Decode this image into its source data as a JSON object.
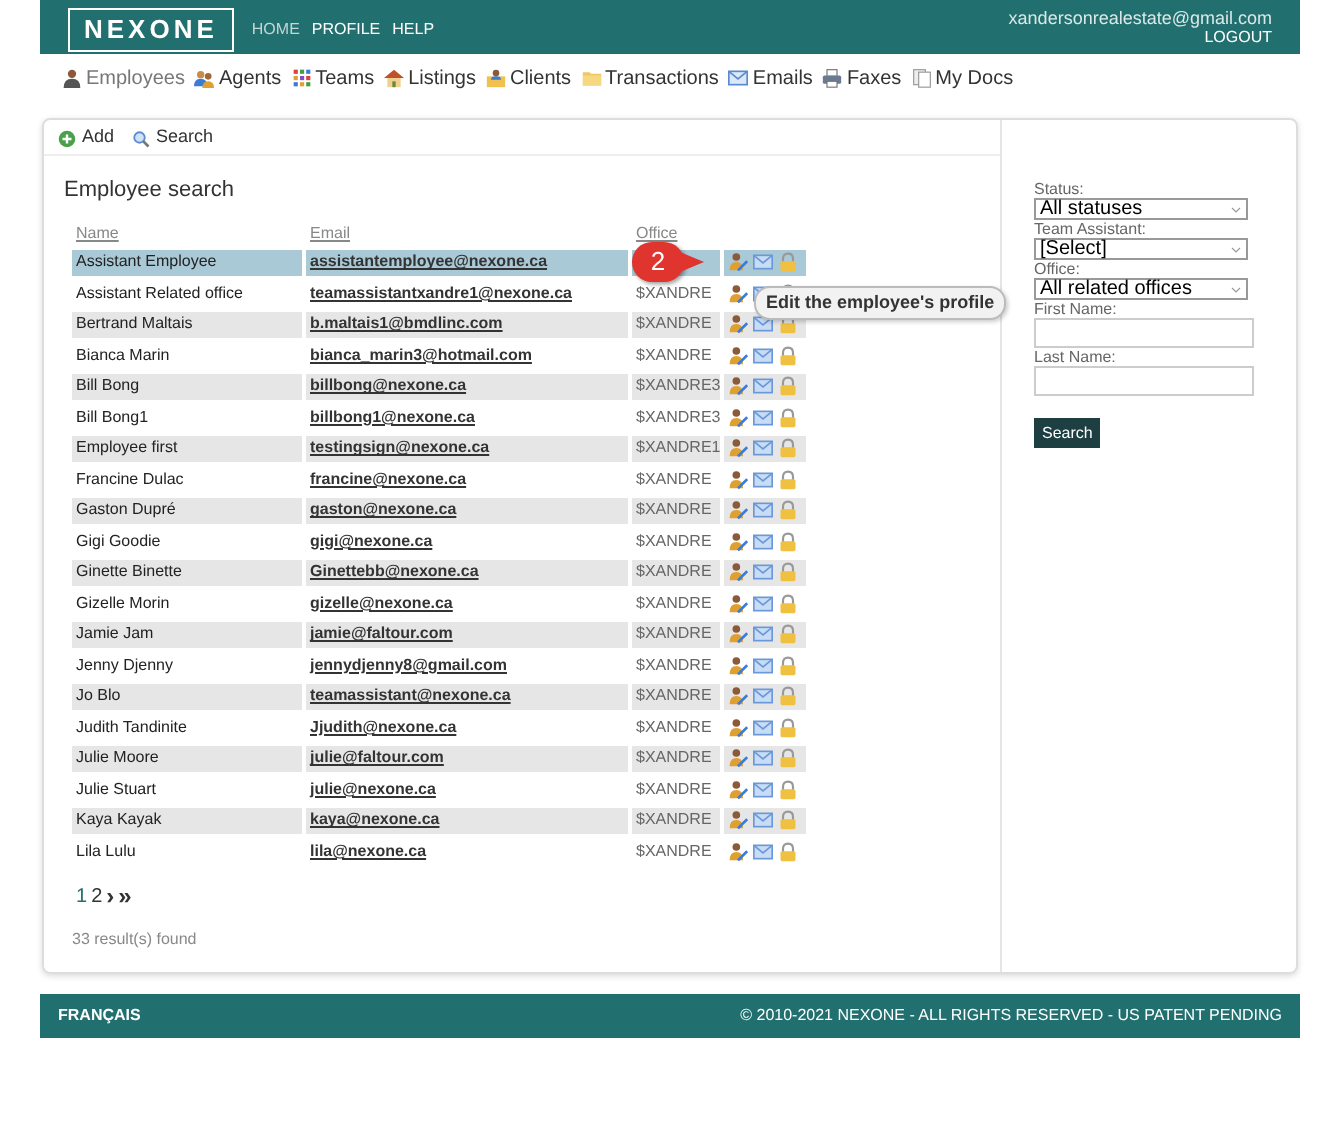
{
  "header": {
    "logo": "NEXONE",
    "nav_links": [
      {
        "label": "HOME",
        "selected": true
      },
      {
        "label": "PROFILE",
        "selected": false
      },
      {
        "label": "HELP",
        "selected": false
      }
    ],
    "user_email": "xandersonrealestate@gmail.com",
    "logout": "LOGOUT"
  },
  "tabs": [
    {
      "label": "Employees",
      "kind": "person",
      "selected": true
    },
    {
      "label": "Agents",
      "kind": "agents",
      "selected": false
    },
    {
      "label": "Teams",
      "kind": "grid",
      "selected": false
    },
    {
      "label": "Listings",
      "kind": "house",
      "selected": false
    },
    {
      "label": "Clients",
      "kind": "clients",
      "selected": false
    },
    {
      "label": "Transactions",
      "kind": "folder",
      "selected": false
    },
    {
      "label": "Emails",
      "kind": "envelope",
      "selected": false
    },
    {
      "label": "Faxes",
      "kind": "printer",
      "selected": false
    },
    {
      "label": "My Docs",
      "kind": "docs",
      "selected": false
    }
  ],
  "toolbar": [
    {
      "label": "Add",
      "kind": "add"
    },
    {
      "label": "Search",
      "kind": "search"
    }
  ],
  "title": "Employee search",
  "table": {
    "columns": [
      "Name",
      "Email",
      "Office"
    ],
    "rows": [
      {
        "name": "Assistant Employee",
        "email": "assistantemployee@nexone.ca",
        "selected": true
      },
      {
        "name": "Assistant Related office",
        "email": "teamassistantxandre1@nexone.ca",
        "office": "$XANDRE",
        "selected": false
      },
      {
        "name": "Bertrand Maltais",
        "email": "b.maltais1@bmdlinc.com",
        "office": "$XANDRE",
        "selected": false
      },
      {
        "name": "Bianca Marin",
        "email": "bianca_marin3@hotmail.com",
        "office": "$XANDRE",
        "selected": false
      },
      {
        "name": "Bill Bong",
        "email": "billbong@nexone.ca",
        "office": "$XANDRE3",
        "selected": false
      },
      {
        "name": "Bill Bong1",
        "email": "billbong1@nexone.ca",
        "office": "$XANDRE3",
        "selected": false
      },
      {
        "name": "Employee first",
        "email": "testingsign@nexone.ca",
        "office": "$XANDRE1",
        "selected": false
      },
      {
        "name": "Francine Dulac",
        "email": "francine@nexone.ca",
        "office": "$XANDRE",
        "selected": false
      },
      {
        "name": "Gaston Dupré",
        "email": "gaston@nexone.ca",
        "office": "$XANDRE",
        "selected": false
      },
      {
        "name": "Gigi Goodie",
        "email": "gigi@nexone.ca",
        "office": "$XANDRE",
        "selected": false
      },
      {
        "name": "Ginette Binette",
        "email": "Ginettebb@nexone.ca",
        "office": "$XANDRE",
        "selected": false
      },
      {
        "name": "Gizelle Morin",
        "email": "gizelle@nexone.ca",
        "office": "$XANDRE",
        "selected": false
      },
      {
        "name": "Jamie Jam",
        "email": "jamie@faltour.com",
        "office": "$XANDRE",
        "selected": false
      },
      {
        "name": "Jenny Djenny",
        "email": "jennydjenny8@gmail.com",
        "office": "$XANDRE",
        "selected": false
      },
      {
        "name": "Jo Blo",
        "email": "teamassistant@nexone.ca",
        "office": "$XANDRE",
        "selected": false
      },
      {
        "name": "Judith Tandinite",
        "email": "Jjudith@nexone.ca",
        "office": "$XANDRE",
        "selected": false
      },
      {
        "name": "Julie Moore",
        "email": "julie@faltour.com",
        "office": "$XANDRE",
        "selected": false
      },
      {
        "name": "Julie Stuart",
        "email": "julie@nexone.ca",
        "office": "$XANDRE",
        "selected": false
      },
      {
        "name": "Kaya Kayak",
        "email": "kaya@nexone.ca",
        "office": "$XANDRE",
        "selected": false
      },
      {
        "name": "Lila Lulu",
        "email": "lila@nexone.ca",
        "office": "$XANDRE",
        "selected": false
      }
    ]
  },
  "pagination": [
    {
      "label": "1",
      "selected": true
    },
    {
      "label": "2",
      "selected": false
    },
    {
      "label": "›",
      "selected": false
    },
    {
      "label": "»",
      "selected": false
    }
  ],
  "results_count": "33 result(s) found",
  "callout": "2",
  "tooltip": "Edit the employee's profile",
  "filters": {
    "status": {
      "label": "Status:",
      "value": "All statuses"
    },
    "team_assistant": {
      "label": "Team Assistant:",
      "value": "[Select]"
    },
    "office": {
      "label": "Office:",
      "value": "All related offices"
    },
    "first_name": {
      "label": "First Name:"
    },
    "last_name": {
      "label": "Last Name:"
    },
    "button": "Search"
  },
  "footer": {
    "language": "FRANÇAIS",
    "copyright": "© 2010-2021 NEXONE - ALL RIGHTS RESERVED - US PATENT PENDING"
  }
}
